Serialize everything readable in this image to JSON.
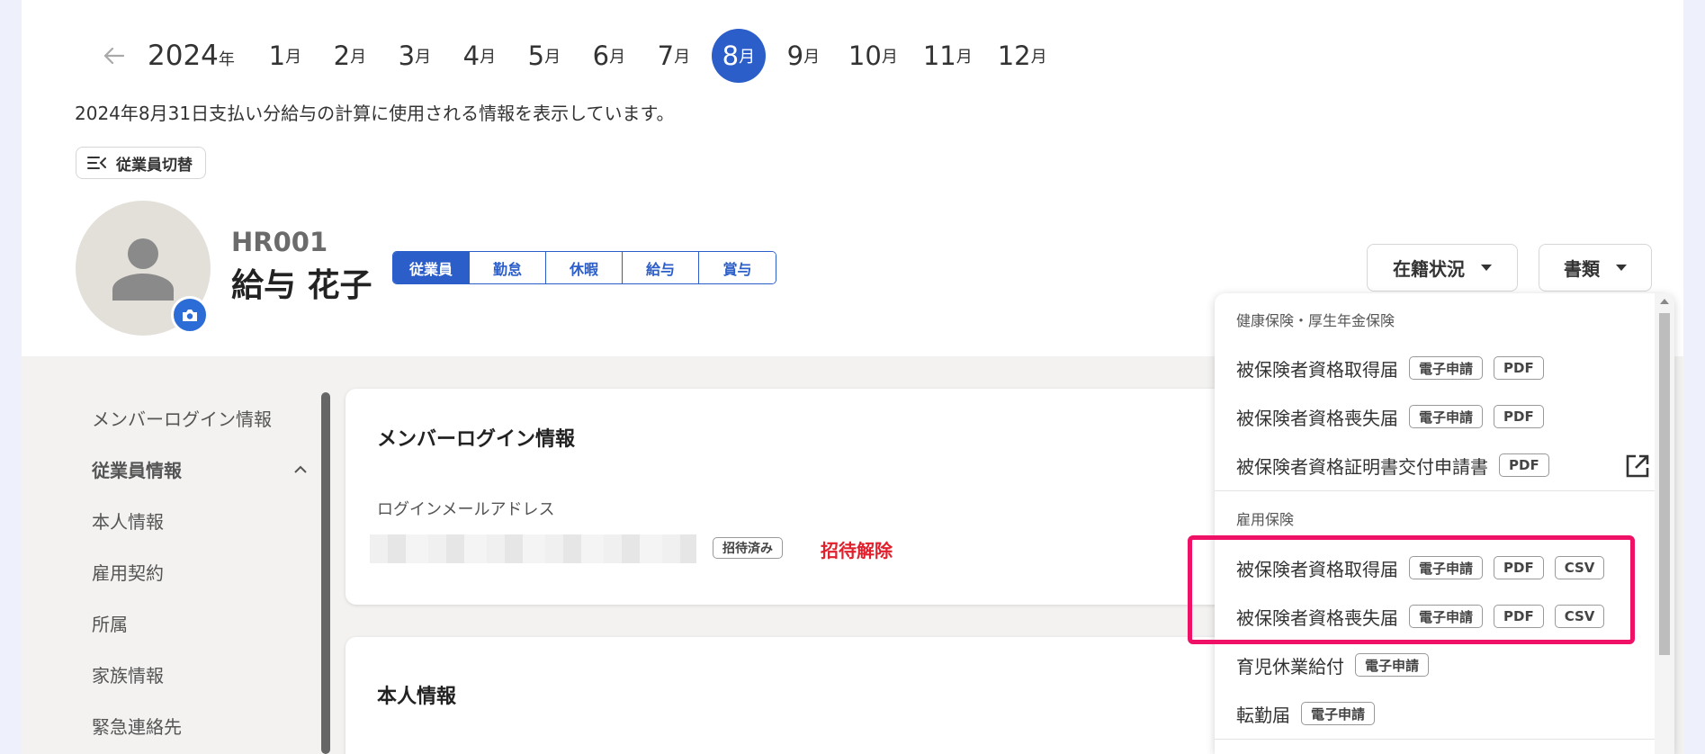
{
  "calendar": {
    "year": "2024",
    "year_suffix": "年",
    "month_suffix": "月",
    "months": [
      "1",
      "2",
      "3",
      "4",
      "5",
      "6",
      "7",
      "8",
      "9",
      "10",
      "11",
      "12"
    ],
    "active_month": "8"
  },
  "info_text": "2024年8月31日支払い分給与の計算に使用される情報を表示しています。",
  "switch_button": "従業員切替",
  "employee": {
    "code": "HR001",
    "name": "給与 花子"
  },
  "tabs": [
    "従業員",
    "勤怠",
    "休暇",
    "給与",
    "賞与"
  ],
  "active_tab": "従業員",
  "header_buttons": {
    "status": "在籍状況",
    "documents": "書類"
  },
  "side_nav": {
    "items": [
      {
        "label": "メンバーログイン情報"
      },
      {
        "label": "従業員情報"
      },
      {
        "label": "本人情報"
      },
      {
        "label": "雇用契約"
      },
      {
        "label": "所属"
      },
      {
        "label": "家族情報"
      },
      {
        "label": "緊急連絡先"
      }
    ]
  },
  "login_card": {
    "title": "メンバーログイン情報",
    "field_label": "ログインメールアドレス",
    "badge": "招待済み",
    "cancel_link": "招待解除"
  },
  "personal_card": {
    "title": "本人情報"
  },
  "documents_menu": {
    "section1": "健康保険・厚生年金保険",
    "section2": "雇用保険",
    "items": [
      {
        "label": "被保険者資格取得届",
        "badges": [
          "電子申請",
          "PDF"
        ]
      },
      {
        "label": "被保険者資格喪失届",
        "badges": [
          "電子申請",
          "PDF"
        ]
      },
      {
        "label": "被保険者資格証明書交付申請書",
        "badges": [
          "PDF"
        ]
      },
      {
        "label": "被保険者資格取得届",
        "badges": [
          "電子申請",
          "PDF",
          "CSV"
        ]
      },
      {
        "label": "被保険者資格喪失届",
        "badges": [
          "電子申請",
          "PDF",
          "CSV"
        ]
      },
      {
        "label": "育児休業給付",
        "badges": [
          "電子申請"
        ]
      },
      {
        "label": "転勤届",
        "badges": [
          "電子申請"
        ]
      }
    ]
  }
}
